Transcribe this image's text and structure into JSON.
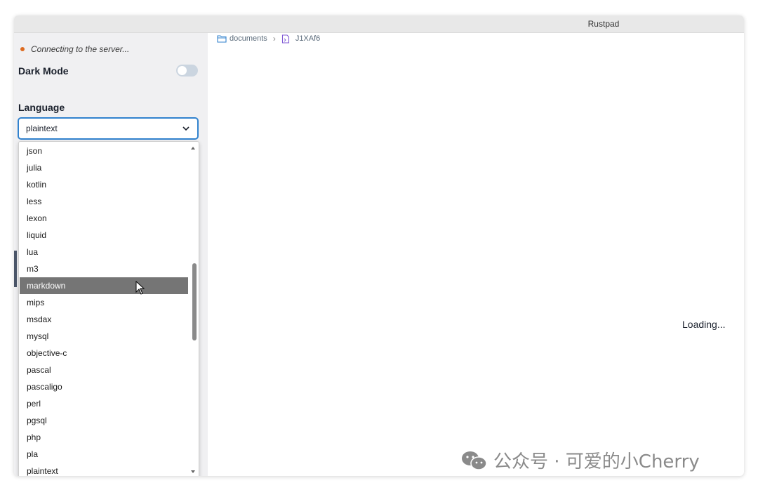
{
  "window": {
    "title": "Rustpad"
  },
  "sidebar": {
    "status": "Connecting to the server...",
    "dark_mode_label": "Dark Mode",
    "dark_mode_on": false,
    "language_label": "Language",
    "language_selected": "plaintext"
  },
  "dropdown": {
    "options": [
      "json",
      "julia",
      "kotlin",
      "less",
      "lexon",
      "liquid",
      "lua",
      "m3",
      "markdown",
      "mips",
      "msdax",
      "mysql",
      "objective-c",
      "pascal",
      "pascaligo",
      "perl",
      "pgsql",
      "php",
      "pla",
      "plaintext"
    ],
    "highlighted": "markdown"
  },
  "breadcrumb": {
    "folder": "documents",
    "file": "J1XAf6"
  },
  "editor": {
    "loading": "Loading..."
  },
  "watermark": {
    "text": "公众号 · 可爱的小Cherry"
  },
  "colors": {
    "accent": "#3182ce",
    "status_dot": "#dd6b20",
    "highlight": "#757575"
  }
}
